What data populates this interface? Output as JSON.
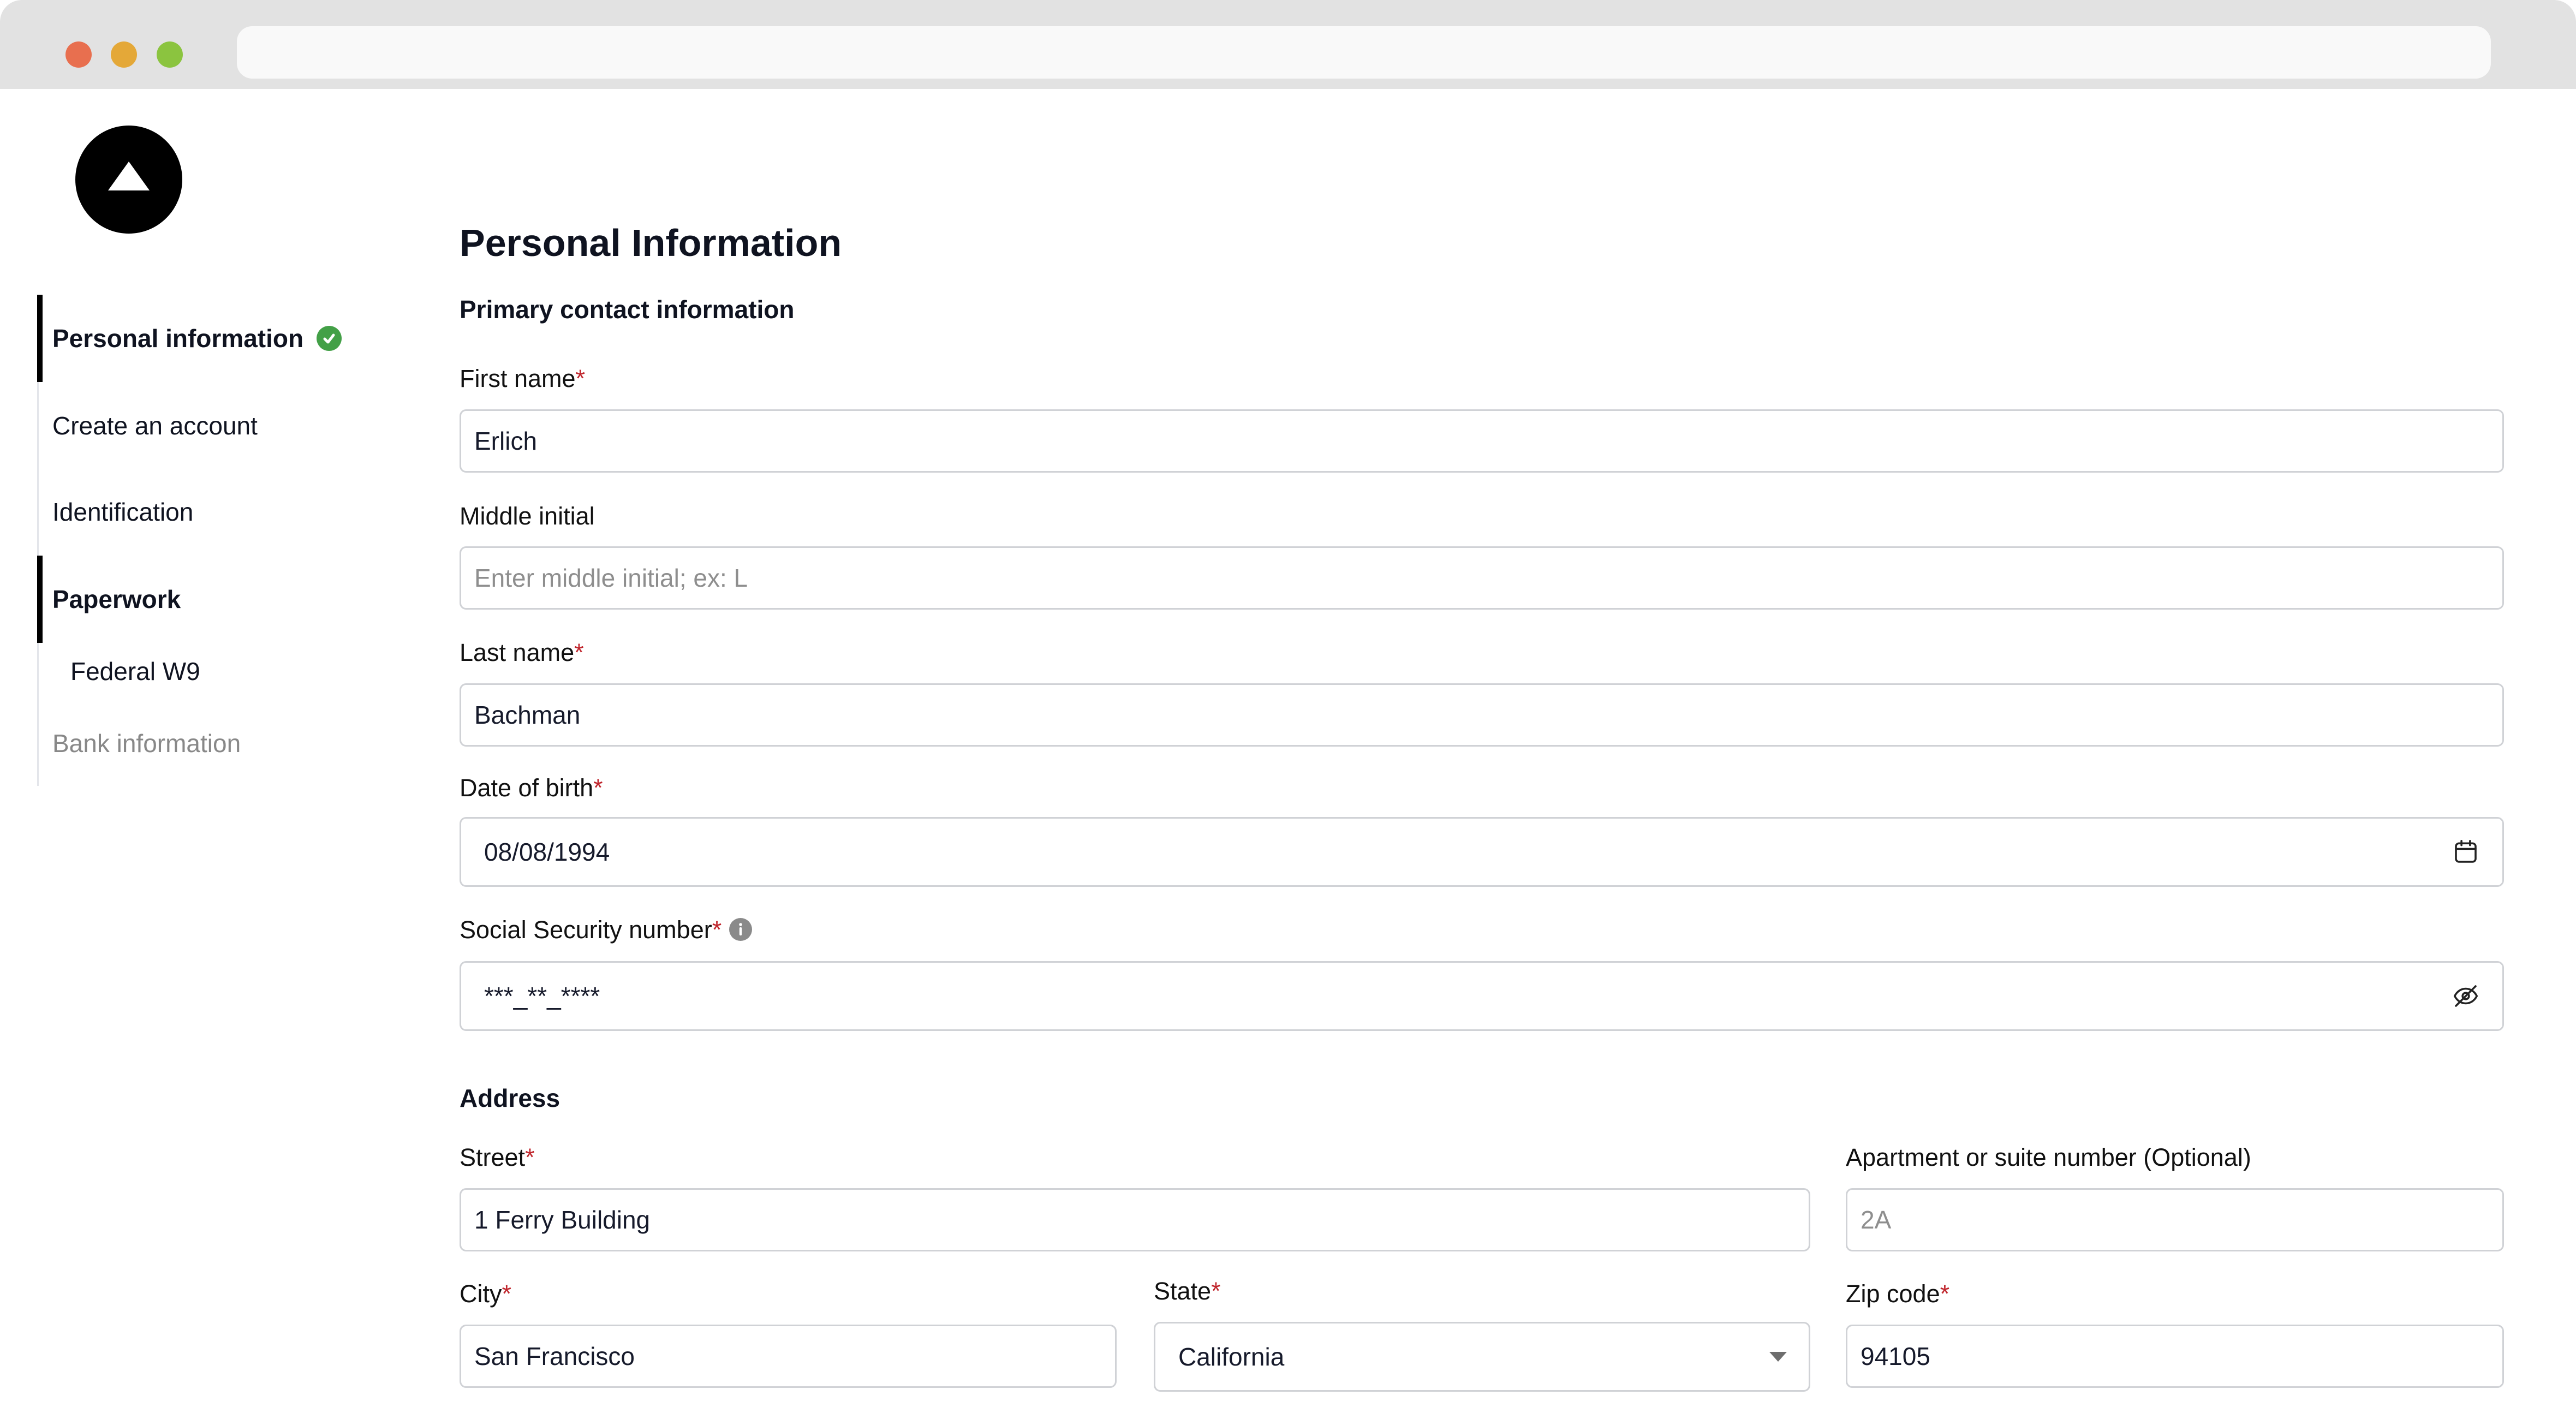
{
  "browser": {
    "traffic_lights": [
      "close",
      "minimize",
      "maximize"
    ],
    "url": ""
  },
  "sidebar": {
    "items": [
      {
        "label": "Personal information",
        "state": "active",
        "completed": true
      },
      {
        "label": "Create an account",
        "state": "default"
      },
      {
        "label": "Identification",
        "state": "default"
      },
      {
        "label": "Paperwork",
        "state": "active"
      },
      {
        "label": "Federal W9",
        "state": "sub"
      },
      {
        "label": "Bank information",
        "state": "disabled"
      }
    ]
  },
  "main": {
    "title": "Personal Information",
    "primary_section": "Primary contact information",
    "address_section": "Address",
    "required_mark": "*",
    "fields": {
      "first_name": {
        "label": "First name",
        "value": "Erlich",
        "required": true
      },
      "middle_initial": {
        "label": "Middle initial",
        "value": "",
        "placeholder": "Enter middle initial; ex: L"
      },
      "last_name": {
        "label": "Last name",
        "value": "Bachman",
        "required": true
      },
      "dob": {
        "label": "Date of birth",
        "value": "08/08/1994",
        "required": true,
        "icon": "calendar-icon"
      },
      "ssn": {
        "label": "Social Security number",
        "value": "***_**_****",
        "required": true,
        "icon": "eye-off-icon",
        "info_icon": "info-icon"
      },
      "street": {
        "label": "Street",
        "value": "1 Ferry Building",
        "required": true
      },
      "apartment": {
        "label": "Apartment or suite number (Optional)",
        "value": "",
        "placeholder": "2A"
      },
      "city": {
        "label": "City",
        "value": "San Francisco",
        "required": true
      },
      "state": {
        "label": "State",
        "value": "California",
        "required": true
      },
      "zip": {
        "label": "Zip code",
        "value": "94105",
        "required": true
      }
    }
  },
  "colors": {
    "accent": "#000000",
    "success": "#43a047",
    "required": "#c0262d",
    "border": "#d0d2d6"
  }
}
